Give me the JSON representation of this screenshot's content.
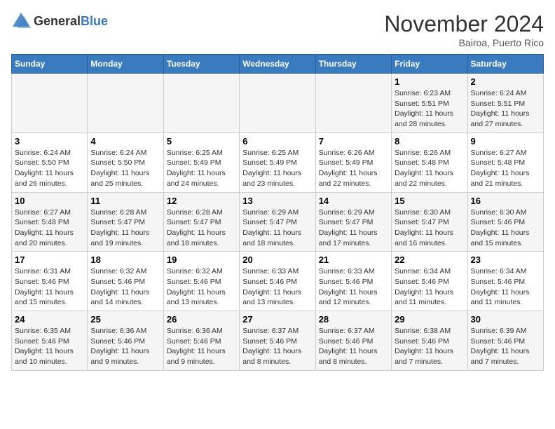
{
  "logo": {
    "general": "General",
    "blue": "Blue"
  },
  "header": {
    "month": "November 2024",
    "location": "Bairoa, Puerto Rico"
  },
  "weekdays": [
    "Sunday",
    "Monday",
    "Tuesday",
    "Wednesday",
    "Thursday",
    "Friday",
    "Saturday"
  ],
  "weeks": [
    [
      {
        "day": "",
        "info": ""
      },
      {
        "day": "",
        "info": ""
      },
      {
        "day": "",
        "info": ""
      },
      {
        "day": "",
        "info": ""
      },
      {
        "day": "",
        "info": ""
      },
      {
        "day": "1",
        "info": "Sunrise: 6:23 AM\nSunset: 5:51 PM\nDaylight: 11 hours and 28 minutes."
      },
      {
        "day": "2",
        "info": "Sunrise: 6:24 AM\nSunset: 5:51 PM\nDaylight: 11 hours and 27 minutes."
      }
    ],
    [
      {
        "day": "3",
        "info": "Sunrise: 6:24 AM\nSunset: 5:50 PM\nDaylight: 11 hours and 26 minutes."
      },
      {
        "day": "4",
        "info": "Sunrise: 6:24 AM\nSunset: 5:50 PM\nDaylight: 11 hours and 25 minutes."
      },
      {
        "day": "5",
        "info": "Sunrise: 6:25 AM\nSunset: 5:49 PM\nDaylight: 11 hours and 24 minutes."
      },
      {
        "day": "6",
        "info": "Sunrise: 6:25 AM\nSunset: 5:49 PM\nDaylight: 11 hours and 23 minutes."
      },
      {
        "day": "7",
        "info": "Sunrise: 6:26 AM\nSunset: 5:49 PM\nDaylight: 11 hours and 22 minutes."
      },
      {
        "day": "8",
        "info": "Sunrise: 6:26 AM\nSunset: 5:48 PM\nDaylight: 11 hours and 22 minutes."
      },
      {
        "day": "9",
        "info": "Sunrise: 6:27 AM\nSunset: 5:48 PM\nDaylight: 11 hours and 21 minutes."
      }
    ],
    [
      {
        "day": "10",
        "info": "Sunrise: 6:27 AM\nSunset: 5:48 PM\nDaylight: 11 hours and 20 minutes."
      },
      {
        "day": "11",
        "info": "Sunrise: 6:28 AM\nSunset: 5:47 PM\nDaylight: 11 hours and 19 minutes."
      },
      {
        "day": "12",
        "info": "Sunrise: 6:28 AM\nSunset: 5:47 PM\nDaylight: 11 hours and 18 minutes."
      },
      {
        "day": "13",
        "info": "Sunrise: 6:29 AM\nSunset: 5:47 PM\nDaylight: 11 hours and 18 minutes."
      },
      {
        "day": "14",
        "info": "Sunrise: 6:29 AM\nSunset: 5:47 PM\nDaylight: 11 hours and 17 minutes."
      },
      {
        "day": "15",
        "info": "Sunrise: 6:30 AM\nSunset: 5:47 PM\nDaylight: 11 hours and 16 minutes."
      },
      {
        "day": "16",
        "info": "Sunrise: 6:30 AM\nSunset: 5:46 PM\nDaylight: 11 hours and 15 minutes."
      }
    ],
    [
      {
        "day": "17",
        "info": "Sunrise: 6:31 AM\nSunset: 5:46 PM\nDaylight: 11 hours and 15 minutes."
      },
      {
        "day": "18",
        "info": "Sunrise: 6:32 AM\nSunset: 5:46 PM\nDaylight: 11 hours and 14 minutes."
      },
      {
        "day": "19",
        "info": "Sunrise: 6:32 AM\nSunset: 5:46 PM\nDaylight: 11 hours and 13 minutes."
      },
      {
        "day": "20",
        "info": "Sunrise: 6:33 AM\nSunset: 5:46 PM\nDaylight: 11 hours and 13 minutes."
      },
      {
        "day": "21",
        "info": "Sunrise: 6:33 AM\nSunset: 5:46 PM\nDaylight: 11 hours and 12 minutes."
      },
      {
        "day": "22",
        "info": "Sunrise: 6:34 AM\nSunset: 5:46 PM\nDaylight: 11 hours and 11 minutes."
      },
      {
        "day": "23",
        "info": "Sunrise: 6:34 AM\nSunset: 5:46 PM\nDaylight: 11 hours and 11 minutes."
      }
    ],
    [
      {
        "day": "24",
        "info": "Sunrise: 6:35 AM\nSunset: 5:46 PM\nDaylight: 11 hours and 10 minutes."
      },
      {
        "day": "25",
        "info": "Sunrise: 6:36 AM\nSunset: 5:46 PM\nDaylight: 11 hours and 9 minutes."
      },
      {
        "day": "26",
        "info": "Sunrise: 6:36 AM\nSunset: 5:46 PM\nDaylight: 11 hours and 9 minutes."
      },
      {
        "day": "27",
        "info": "Sunrise: 6:37 AM\nSunset: 5:46 PM\nDaylight: 11 hours and 8 minutes."
      },
      {
        "day": "28",
        "info": "Sunrise: 6:37 AM\nSunset: 5:46 PM\nDaylight: 11 hours and 8 minutes."
      },
      {
        "day": "29",
        "info": "Sunrise: 6:38 AM\nSunset: 5:46 PM\nDaylight: 11 hours and 7 minutes."
      },
      {
        "day": "30",
        "info": "Sunrise: 6:39 AM\nSunset: 5:46 PM\nDaylight: 11 hours and 7 minutes."
      }
    ]
  ]
}
